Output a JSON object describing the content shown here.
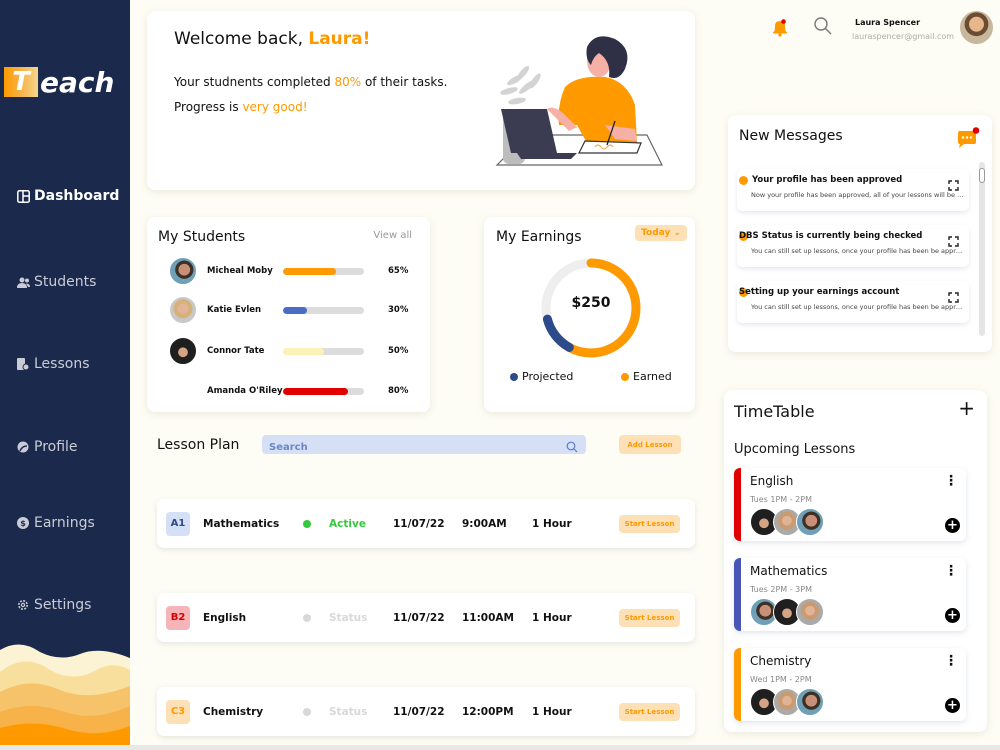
{
  "brand": {
    "logo_letter": "T",
    "logo_word": "each"
  },
  "sidebar": {
    "items": [
      {
        "label": "Dashboard",
        "icon": "dashboard-icon",
        "active": true
      },
      {
        "label": "Students",
        "icon": "users-icon",
        "active": false
      },
      {
        "label": "Lessons",
        "icon": "lessons-icon",
        "active": false
      },
      {
        "label": "Profile",
        "icon": "profile-icon",
        "active": false
      },
      {
        "label": "Earnings",
        "icon": "dollar-icon",
        "active": false
      },
      {
        "label": "Settings",
        "icon": "gear-icon",
        "active": false
      }
    ]
  },
  "header": {
    "user_name": "Laura Spencer",
    "user_email": "lauraspencer@gmail.com",
    "notification_icon": "bell-icon",
    "search_icon": "search-icon"
  },
  "welcome": {
    "greeting": "Welcome back, ",
    "name": "Laura!",
    "line1_pre": "Your studnents completed ",
    "line1_pct": "80%",
    "line1_post": " of their tasks.",
    "line2_pre": "Progress is ",
    "line2_accent": "very good!"
  },
  "students": {
    "title": "My Students",
    "view_all": "View all",
    "rows": [
      {
        "name": "Micheal Moby",
        "percent_label": "65%",
        "progress": 0.65,
        "color": "#ff9900"
      },
      {
        "name": "Katie Evlen",
        "percent_label": "30%",
        "progress": 0.3,
        "color": "#4a6cc4"
      },
      {
        "name": "Connor Tate",
        "percent_label": "50%",
        "progress": 0.5,
        "color": "#fbf2b8"
      },
      {
        "name": "Amanda O'Riley",
        "percent_label": "80%",
        "progress": 0.8,
        "color": "#e00000"
      }
    ]
  },
  "earnings": {
    "title": "My Earnings",
    "period": "Today",
    "total": "$250",
    "earned_fraction": 0.58,
    "projected_fraction": 0.13,
    "legend": [
      {
        "label": "Projected",
        "color": "#2d4a8a"
      },
      {
        "label": "Earned",
        "color": "#ff9900"
      }
    ]
  },
  "lesson_plan": {
    "title": "Lesson Plan",
    "search_placeholder": "Search",
    "add_label": "Add Lesson",
    "rows": [
      {
        "code": "A1",
        "code_bg": "#d5e0f7",
        "code_color": "#2d4a8a",
        "subject": "Mathematics",
        "status": "Active",
        "status_color": "#36c93e",
        "dot_color": "#36c93e",
        "date": "11/07/22",
        "time": "9:00AM",
        "duration": "1 Hour",
        "action": "Start Lesson"
      },
      {
        "code": "B2",
        "code_bg": "#f7b4b8",
        "code_color": "#d60000",
        "subject": "English",
        "status": "Status",
        "status_color": "#d8d8d8",
        "dot_color": "#d8d8d8",
        "date": "11/07/22",
        "time": "11:00AM",
        "duration": "1 Hour",
        "action": "Start Lesson"
      },
      {
        "code": "C3",
        "code_bg": "#fde0b5",
        "code_color": "#ff9900",
        "subject": "Chemistry",
        "status": "Status",
        "status_color": "#d8d8d8",
        "dot_color": "#d8d8d8",
        "date": "11/07/22",
        "time": "12:00PM",
        "duration": "1 Hour",
        "action": "Start Lesson"
      }
    ]
  },
  "messages": {
    "title": "New Messages",
    "items": [
      {
        "title": "Your profile has been approved",
        "body": "Now your profile has been approved, all of your lessons will be available soon"
      },
      {
        "title": "DBS Status is currently being checked",
        "body": "You can still set up lessons, once your profile has been be approved"
      },
      {
        "title": "Setting up your earnings account",
        "body": "You can still set up lessons, once your profile has been be approved"
      }
    ]
  },
  "timetable": {
    "title": "TimeTable",
    "subtitle": "Upcoming Lessons",
    "lessons": [
      {
        "subject": "English",
        "time": "Tues 1PM - 2PM",
        "color": "#e00000"
      },
      {
        "subject": "Mathematics",
        "time": "Tues 2PM - 3PM",
        "color": "#4a55b8"
      },
      {
        "subject": "Chemistry",
        "time": "Wed 1PM - 2PM",
        "color": "#ff9900"
      }
    ]
  }
}
